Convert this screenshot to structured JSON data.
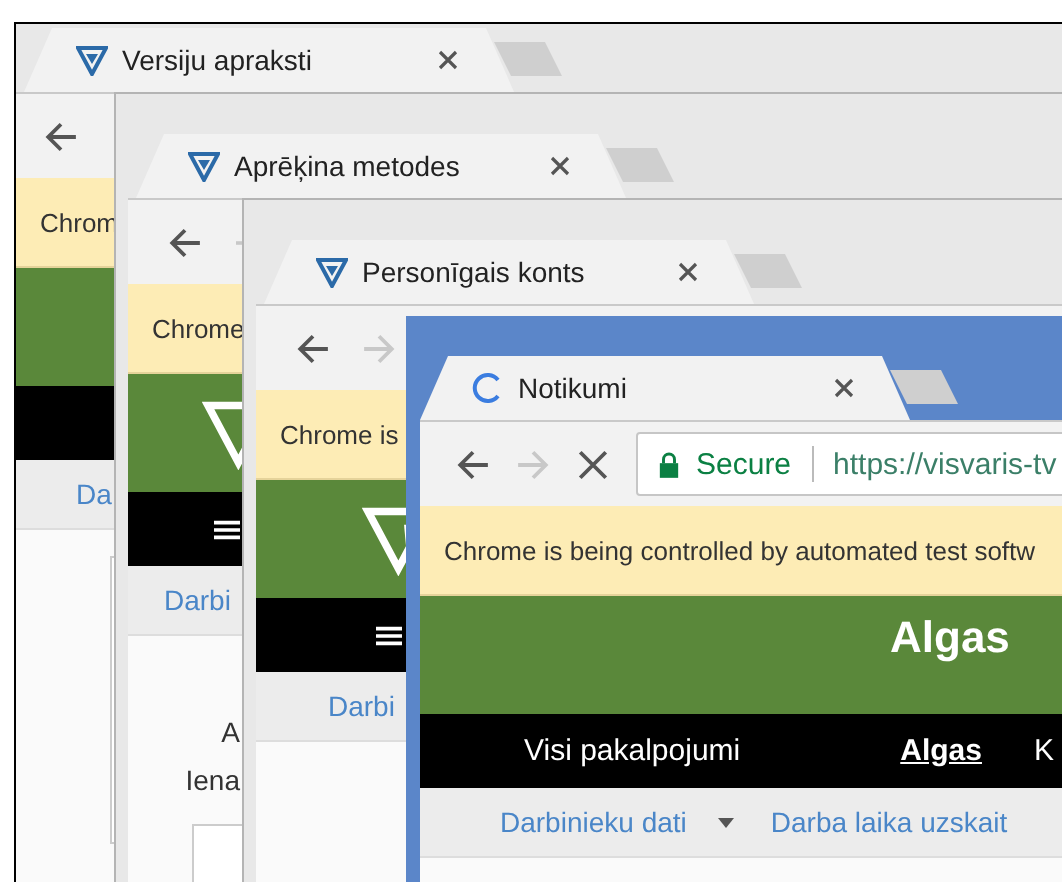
{
  "windows": [
    {
      "active": false,
      "tab": {
        "title": "Versiju apraksti",
        "loading": false
      },
      "infobar": "Chrom",
      "nav": [
        {
          "label": "Da"
        }
      ],
      "content": {
        "kind": "panel"
      }
    },
    {
      "active": false,
      "tab": {
        "title": "Aprēķina metodes",
        "loading": false
      },
      "infobar": "Chrome",
      "header_logo": true,
      "hamburger": true,
      "nav": [
        {
          "label": "Darbi"
        }
      ],
      "content": {
        "kind": "text",
        "lines": [
          "A",
          "Iena"
        ]
      }
    },
    {
      "active": false,
      "tab": {
        "title": "Personīgais konts",
        "loading": false
      },
      "infobar": "Chrome is",
      "header_logo": true,
      "hamburger": true,
      "nav": [
        {
          "label": "Darbi"
        }
      ]
    },
    {
      "active": true,
      "tab": {
        "title": "Notikumi",
        "loading": true
      },
      "address": {
        "security": "Secure",
        "url": "https://visvaris-tv"
      },
      "infobar": "Chrome is being controlled by automated test softw",
      "header_title": "Algas",
      "menu_items": [
        {
          "label": "Visi pakalpojumi",
          "selected": false
        },
        {
          "label": "Algas",
          "selected": true
        },
        {
          "label": "K",
          "selected": false
        }
      ],
      "nav": [
        {
          "label": "Darbinieku dati",
          "dropdown": true
        },
        {
          "label": "Darba laika uzskait",
          "dropdown": false
        }
      ]
    }
  ]
}
